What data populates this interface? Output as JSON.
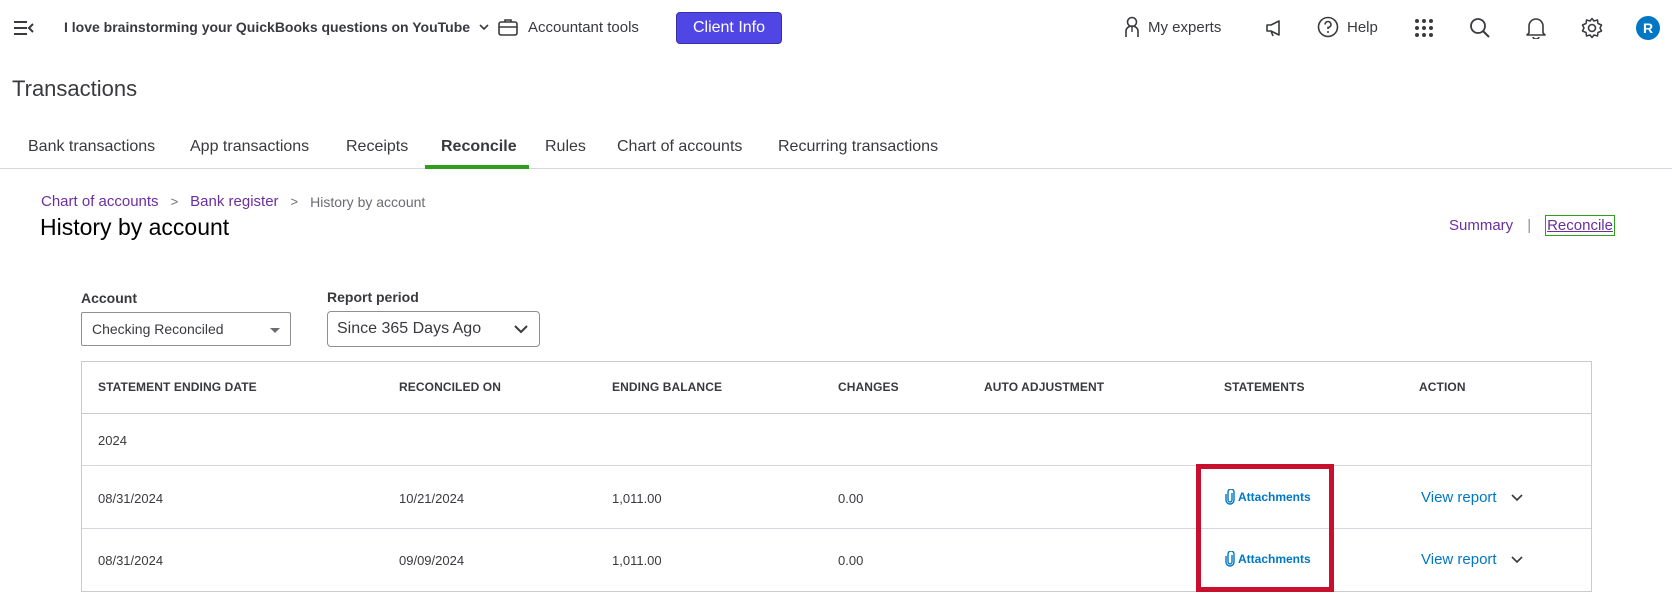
{
  "topbar": {
    "company_name": "I love brainstorming your QuickBooks questions on YouTube",
    "accountant_tools": "Accountant tools",
    "client_info": "Client Info",
    "client_info_color": "#4f46e5",
    "my_experts": "My experts",
    "help": "Help",
    "avatar_initial": "R",
    "icons": [
      "menu-icon",
      "briefcase-icon",
      "person-icon",
      "megaphone-icon",
      "help-icon",
      "apps-grid-icon",
      "search-icon",
      "bell-icon",
      "gear-icon"
    ]
  },
  "page": {
    "title": "Transactions"
  },
  "tabs": [
    {
      "label": "Bank transactions"
    },
    {
      "label": "App transactions"
    },
    {
      "label": "Receipts"
    },
    {
      "label": "Reconcile",
      "active": true
    },
    {
      "label": "Rules"
    },
    {
      "label": "Chart of accounts"
    },
    {
      "label": "Recurring transactions"
    }
  ],
  "breadcrumb": {
    "items": [
      "Chart of accounts",
      "Bank register"
    ],
    "separator": ">",
    "current": "History by account"
  },
  "subpage": {
    "title": "History by account",
    "summary_link": "Summary",
    "divider": "|",
    "reconcile_link": "Reconcile"
  },
  "filters": {
    "account_label": "Account",
    "account_value": "Checking Reconciled",
    "period_label": "Report period",
    "period_value": "Since 365 Days Ago"
  },
  "table": {
    "columns": [
      "STATEMENT ENDING DATE",
      "RECONCILED ON",
      "ENDING BALANCE",
      "CHANGES",
      "AUTO ADJUSTMENT",
      "STATEMENTS",
      "ACTION"
    ],
    "group": "2024",
    "rows": [
      {
        "statement_ending_date": "08/31/2024",
        "reconciled_on": "10/21/2024",
        "ending_balance": "1,011.00",
        "changes": "0.00",
        "auto_adjustment": "",
        "statements": "Attachments",
        "action": "View report"
      },
      {
        "statement_ending_date": "08/31/2024",
        "reconciled_on": "09/09/2024",
        "ending_balance": "1,011.00",
        "changes": "0.00",
        "auto_adjustment": "",
        "statements": "Attachments",
        "action": "View report"
      }
    ]
  },
  "colors": {
    "link_purple": "#6b2fa0",
    "link_blue": "#0077c5",
    "tab_active": "#2ca01c",
    "highlight": "#c8102e"
  }
}
